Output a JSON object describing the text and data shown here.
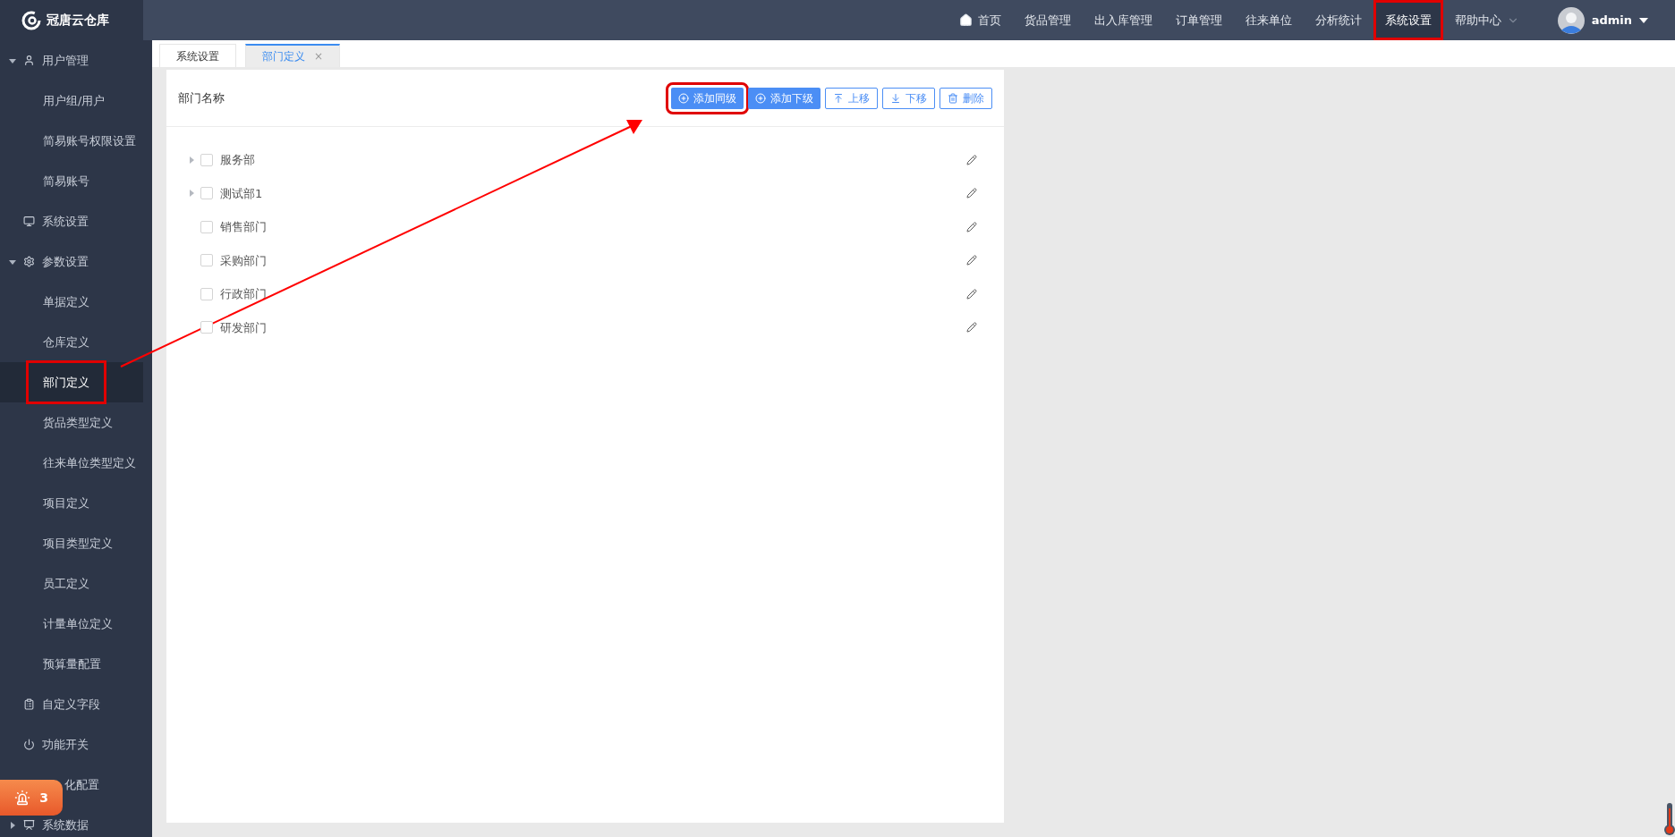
{
  "logo": {
    "text": "冠唐云仓库"
  },
  "nav": [
    {
      "label": "首页",
      "selected": false,
      "highlighted": false,
      "kind": "home"
    },
    {
      "label": "货品管理",
      "selected": false,
      "highlighted": false,
      "kind": "plain"
    },
    {
      "label": "出入库管理",
      "selected": false,
      "highlighted": false,
      "kind": "plain"
    },
    {
      "label": "订单管理",
      "selected": false,
      "highlighted": false,
      "kind": "plain"
    },
    {
      "label": "往来单位",
      "selected": false,
      "highlighted": false,
      "kind": "plain"
    },
    {
      "label": "分析统计",
      "selected": false,
      "highlighted": false,
      "kind": "plain"
    },
    {
      "label": "系统设置",
      "selected": true,
      "highlighted": true,
      "kind": "plain"
    },
    {
      "label": "帮助中心",
      "selected": false,
      "highlighted": false,
      "kind": "dropdown"
    }
  ],
  "user": {
    "name": "admin"
  },
  "sidebar": [
    {
      "label": "用户管理",
      "expandable": true,
      "expanded": true,
      "selected": false,
      "children": [
        {
          "label": "用户组/用户",
          "selected": false,
          "highlighted": false
        },
        {
          "label": "简易账号权限设置",
          "selected": false,
          "highlighted": false
        },
        {
          "label": "简易账号",
          "selected": false,
          "highlighted": false
        }
      ]
    },
    {
      "label": "系统设置",
      "expandable": false,
      "selected": false
    },
    {
      "label": "参数设置",
      "expandable": true,
      "expanded": true,
      "selected": false,
      "children": [
        {
          "label": "单据定义",
          "selected": false,
          "highlighted": false
        },
        {
          "label": "仓库定义",
          "selected": false,
          "highlighted": false
        },
        {
          "label": "部门定义",
          "selected": true,
          "highlighted": true
        },
        {
          "label": "货品类型定义",
          "selected": false,
          "highlighted": false
        },
        {
          "label": "往来单位类型定义",
          "selected": false,
          "highlighted": false
        },
        {
          "label": "项目定义",
          "selected": false,
          "highlighted": false
        },
        {
          "label": "项目类型定义",
          "selected": false,
          "highlighted": false
        },
        {
          "label": "员工定义",
          "selected": false,
          "highlighted": false
        },
        {
          "label": "计量单位定义",
          "selected": false,
          "highlighted": false
        },
        {
          "label": "预算量配置",
          "selected": false,
          "highlighted": false
        }
      ]
    },
    {
      "label": "自定义字段",
      "expandable": false,
      "selected": false
    },
    {
      "label": "功能开关",
      "expandable": false,
      "selected": false
    },
    {
      "label": "化配置",
      "expandable": false,
      "selected": false
    },
    {
      "label": "系统数据",
      "expandable": true,
      "expanded": false,
      "selected": false
    }
  ],
  "alert_badge": {
    "count": "3"
  },
  "tabs": [
    {
      "label": "系统设置",
      "selected": false,
      "closable": false
    },
    {
      "label": "部门定义",
      "selected": true,
      "closable": true,
      "close": "×"
    }
  ],
  "panel": {
    "title": "部门名称",
    "buttons": [
      {
        "label": "添加同级",
        "kind": "primary",
        "highlighted": true
      },
      {
        "label": "添加下级",
        "kind": "primary",
        "highlighted": false
      },
      {
        "label": "上移",
        "kind": "outline",
        "highlighted": false
      },
      {
        "label": "下移",
        "kind": "outline",
        "highlighted": false
      },
      {
        "label": "删除",
        "kind": "outline",
        "highlighted": false
      }
    ],
    "tree": [
      {
        "label": "服务部",
        "expandable": true,
        "checked": false
      },
      {
        "label": "测试部1",
        "expandable": true,
        "checked": false
      },
      {
        "label": "销售部门",
        "expandable": false,
        "checked": false
      },
      {
        "label": "采购部门",
        "expandable": false,
        "checked": false
      },
      {
        "label": "行政部门",
        "expandable": false,
        "checked": false
      },
      {
        "label": "研发部门",
        "expandable": false,
        "checked": false
      }
    ]
  }
}
